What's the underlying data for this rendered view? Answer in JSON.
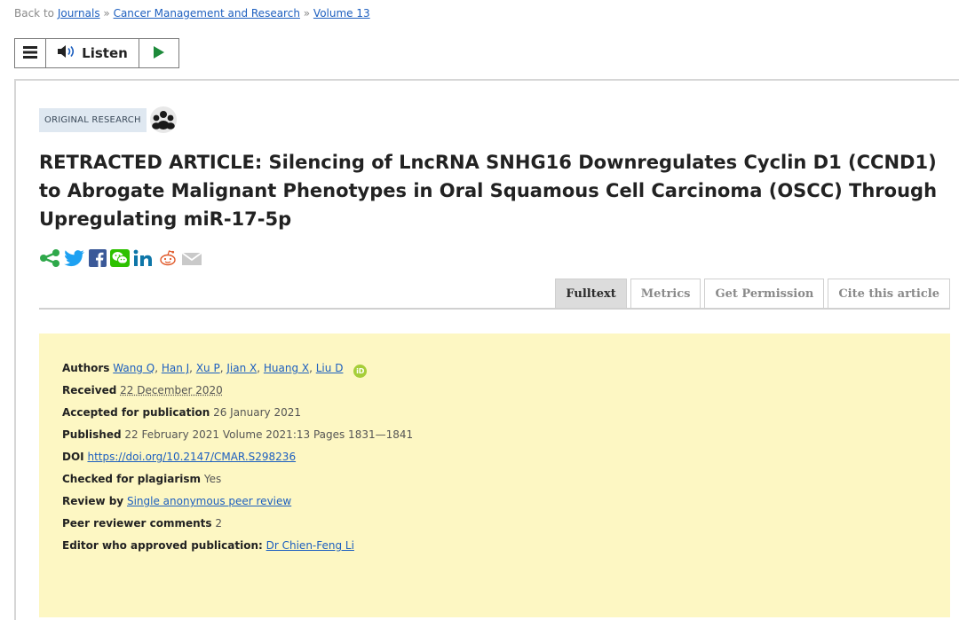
{
  "breadcrumb": {
    "prefix": "Back to ",
    "items": [
      "Journals",
      "Cancer Management and Research",
      "Volume 13"
    ],
    "separator": " » "
  },
  "toolbar": {
    "menu_icon": "hamburger-menu-icon",
    "listen_label": "Listen",
    "listen_icon": "speaker-icon",
    "play_icon": "play-icon"
  },
  "article": {
    "category": "ORIGINAL RESEARCH",
    "category_icon": "group-icon",
    "title": "RETRACTED ARTICLE: Silencing of LncRNA SNHG16 Downregulates Cyclin D1 (CCND1) to Abrogate Malignant Phenotypes in Oral Squamous Cell Carcinoma (OSCC) Through Upregulating miR-17-5p"
  },
  "social": [
    "share-icon",
    "twitter-icon",
    "facebook-icon",
    "wechat-icon",
    "linkedin-icon",
    "reddit-icon",
    "email-icon"
  ],
  "tabs": [
    {
      "label": "Fulltext",
      "active": true
    },
    {
      "label": "Metrics",
      "active": false
    },
    {
      "label": "Get Permission",
      "active": false
    },
    {
      "label": "Cite this article",
      "active": false
    }
  ],
  "meta": {
    "authors_label": "Authors",
    "authors": [
      "Wang Q",
      "Han J",
      "Xu P",
      "Jian X",
      "Huang X",
      "Liu D"
    ],
    "orcid_icon": "orcid-icon",
    "received_label": "Received",
    "received": "22 December 2020",
    "accepted_label": "Accepted for publication",
    "accepted": "26 January 2021",
    "published_label": "Published",
    "published": "22 February 2021 Volume 2021:13 Pages 1831—1841",
    "doi_label": "DOI",
    "doi": "https://doi.org/10.2147/CMAR.S298236",
    "plagiarism_label": "Checked for plagiarism",
    "plagiarism": "Yes",
    "review_label": "Review by",
    "review": "Single anonymous peer review",
    "peer_label": "Peer reviewer comments",
    "peer": "2",
    "editor_label": "Editor who approved publication:",
    "editor": "Dr Chien-Feng Li"
  },
  "colors": {
    "link": "#1d5fbf",
    "meta_background": "#fdf7c3",
    "share_green": "#2ea84a",
    "twitter_blue": "#1da1f2",
    "facebook_blue": "#3b5998",
    "wechat_green": "#2dc100",
    "linkedin_blue": "#0e76a8"
  }
}
